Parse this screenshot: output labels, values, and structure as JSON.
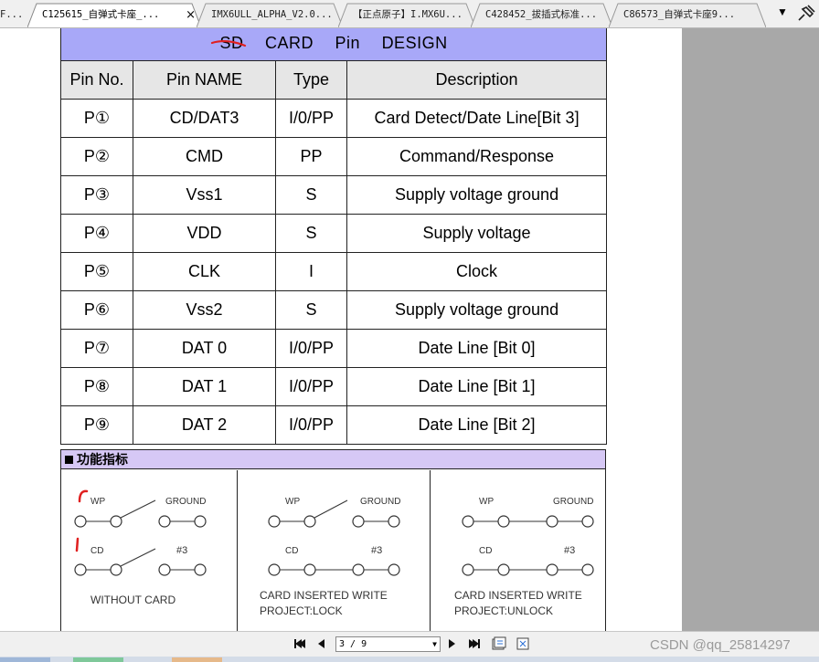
{
  "tabs": [
    {
      "label": "F..."
    },
    {
      "label": "C125615_自弹式卡座_..."
    },
    {
      "label": "IMX6ULL_ALPHA_V2.0..."
    },
    {
      "label": "【正点原子】I.MX6U..."
    },
    {
      "label": "C428452_拔插式标准..."
    },
    {
      "label": "C86573_自弹式卡座9..."
    }
  ],
  "tab_close_glyph": "×",
  "menu_glyph": "▼",
  "pin_table": {
    "title_words": [
      "SD",
      "CARD",
      "Pin",
      "DESIGN"
    ],
    "headers": [
      "Pin No.",
      "Pin NAME",
      "Type",
      "Description"
    ],
    "rows": [
      {
        "no": "P①",
        "name": "CD/DAT3",
        "type": "I/0/PP",
        "desc": "Card Detect/Date Line[Bit 3]"
      },
      {
        "no": "P②",
        "name": "CMD",
        "type": "PP",
        "desc": "Command/Response"
      },
      {
        "no": "P③",
        "name": "Vss1",
        "type": "S",
        "desc": "Supply voltage ground"
      },
      {
        "no": "P④",
        "name": "VDD",
        "type": "S",
        "desc": "Supply voltage"
      },
      {
        "no": "P⑤",
        "name": "CLK",
        "type": "I",
        "desc": "Clock"
      },
      {
        "no": "P⑥",
        "name": "Vss2",
        "type": "S",
        "desc": "Supply voltage ground"
      },
      {
        "no": "P⑦",
        "name": "DAT 0",
        "type": "I/0/PP",
        "desc": "Date Line [Bit 0]"
      },
      {
        "no": "P⑧",
        "name": "DAT 1",
        "type": "I/0/PP",
        "desc": "Date Line [Bit 1]"
      },
      {
        "no": "P⑨",
        "name": "DAT 2",
        "type": "I/0/PP",
        "desc": "Date Line [Bit 2]"
      }
    ]
  },
  "function_section": {
    "title": "功能指标",
    "labels": {
      "wp": "WP",
      "ground": "GROUND",
      "cd": "CD",
      "pin3": "#3"
    },
    "panels": [
      {
        "caption1": "WITHOUT  CARD",
        "caption2": ""
      },
      {
        "caption1": "CARD  INSERTED  WRITE",
        "caption2": "PROJECT:LOCK"
      },
      {
        "caption1": "CARD  INSERTED  WRITE",
        "caption2": "PROJECT:UNLOCK"
      }
    ]
  },
  "navigation": {
    "page_value": "3 / 9"
  },
  "watermark": "CSDN @qq_25814297",
  "colors": {
    "title_row": "#a8a8f8",
    "func_header": "#d6c8f5",
    "annotation": "#e02020",
    "viewer_bg": "#a8a8a8"
  }
}
